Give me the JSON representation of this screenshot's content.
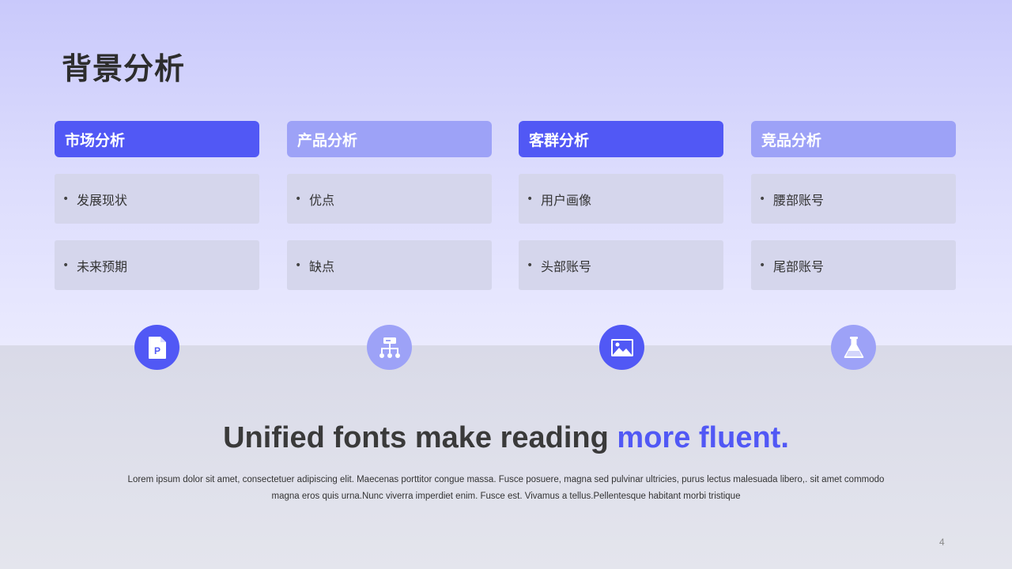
{
  "page": {
    "title": "背景分析",
    "page_number": "4"
  },
  "columns": [
    {
      "header": "市场分析",
      "style": "dark",
      "items": [
        "发展现状",
        "未来预期"
      ],
      "icon": "pdf-document-icon"
    },
    {
      "header": "产品分析",
      "style": "light",
      "items": [
        "优点",
        "缺点"
      ],
      "icon": "sitemap-hierarchy-icon"
    },
    {
      "header": "客群分析",
      "style": "dark",
      "items": [
        "用户画像",
        "头部账号"
      ],
      "icon": "image-picture-icon"
    },
    {
      "header": "竞品分析",
      "style": "light",
      "items": [
        "腰部账号",
        "尾部账号"
      ],
      "icon": "flask-beaker-icon"
    }
  ],
  "bullet": "•",
  "headline": {
    "part1": "Unified fonts make reading ",
    "accent": "more fluent."
  },
  "body_text": "Lorem ipsum dolor sit amet, consectetuer adipiscing elit. Maecenas porttitor congue massa. Fusce posuere, magna sed pulvinar ultricies, purus lectus malesuada libero,. sit amet commodo magna eros quis urna.Nunc viverra imperdiet enim. Fusce est. Vivamus a tellus.Pellentesque habitant morbi tristique",
  "colors": {
    "accent_dark": "#5158f5",
    "accent_light": "#9da2f7",
    "item_bg": "#d5d6ec",
    "title_text": "#2d2d2d"
  }
}
